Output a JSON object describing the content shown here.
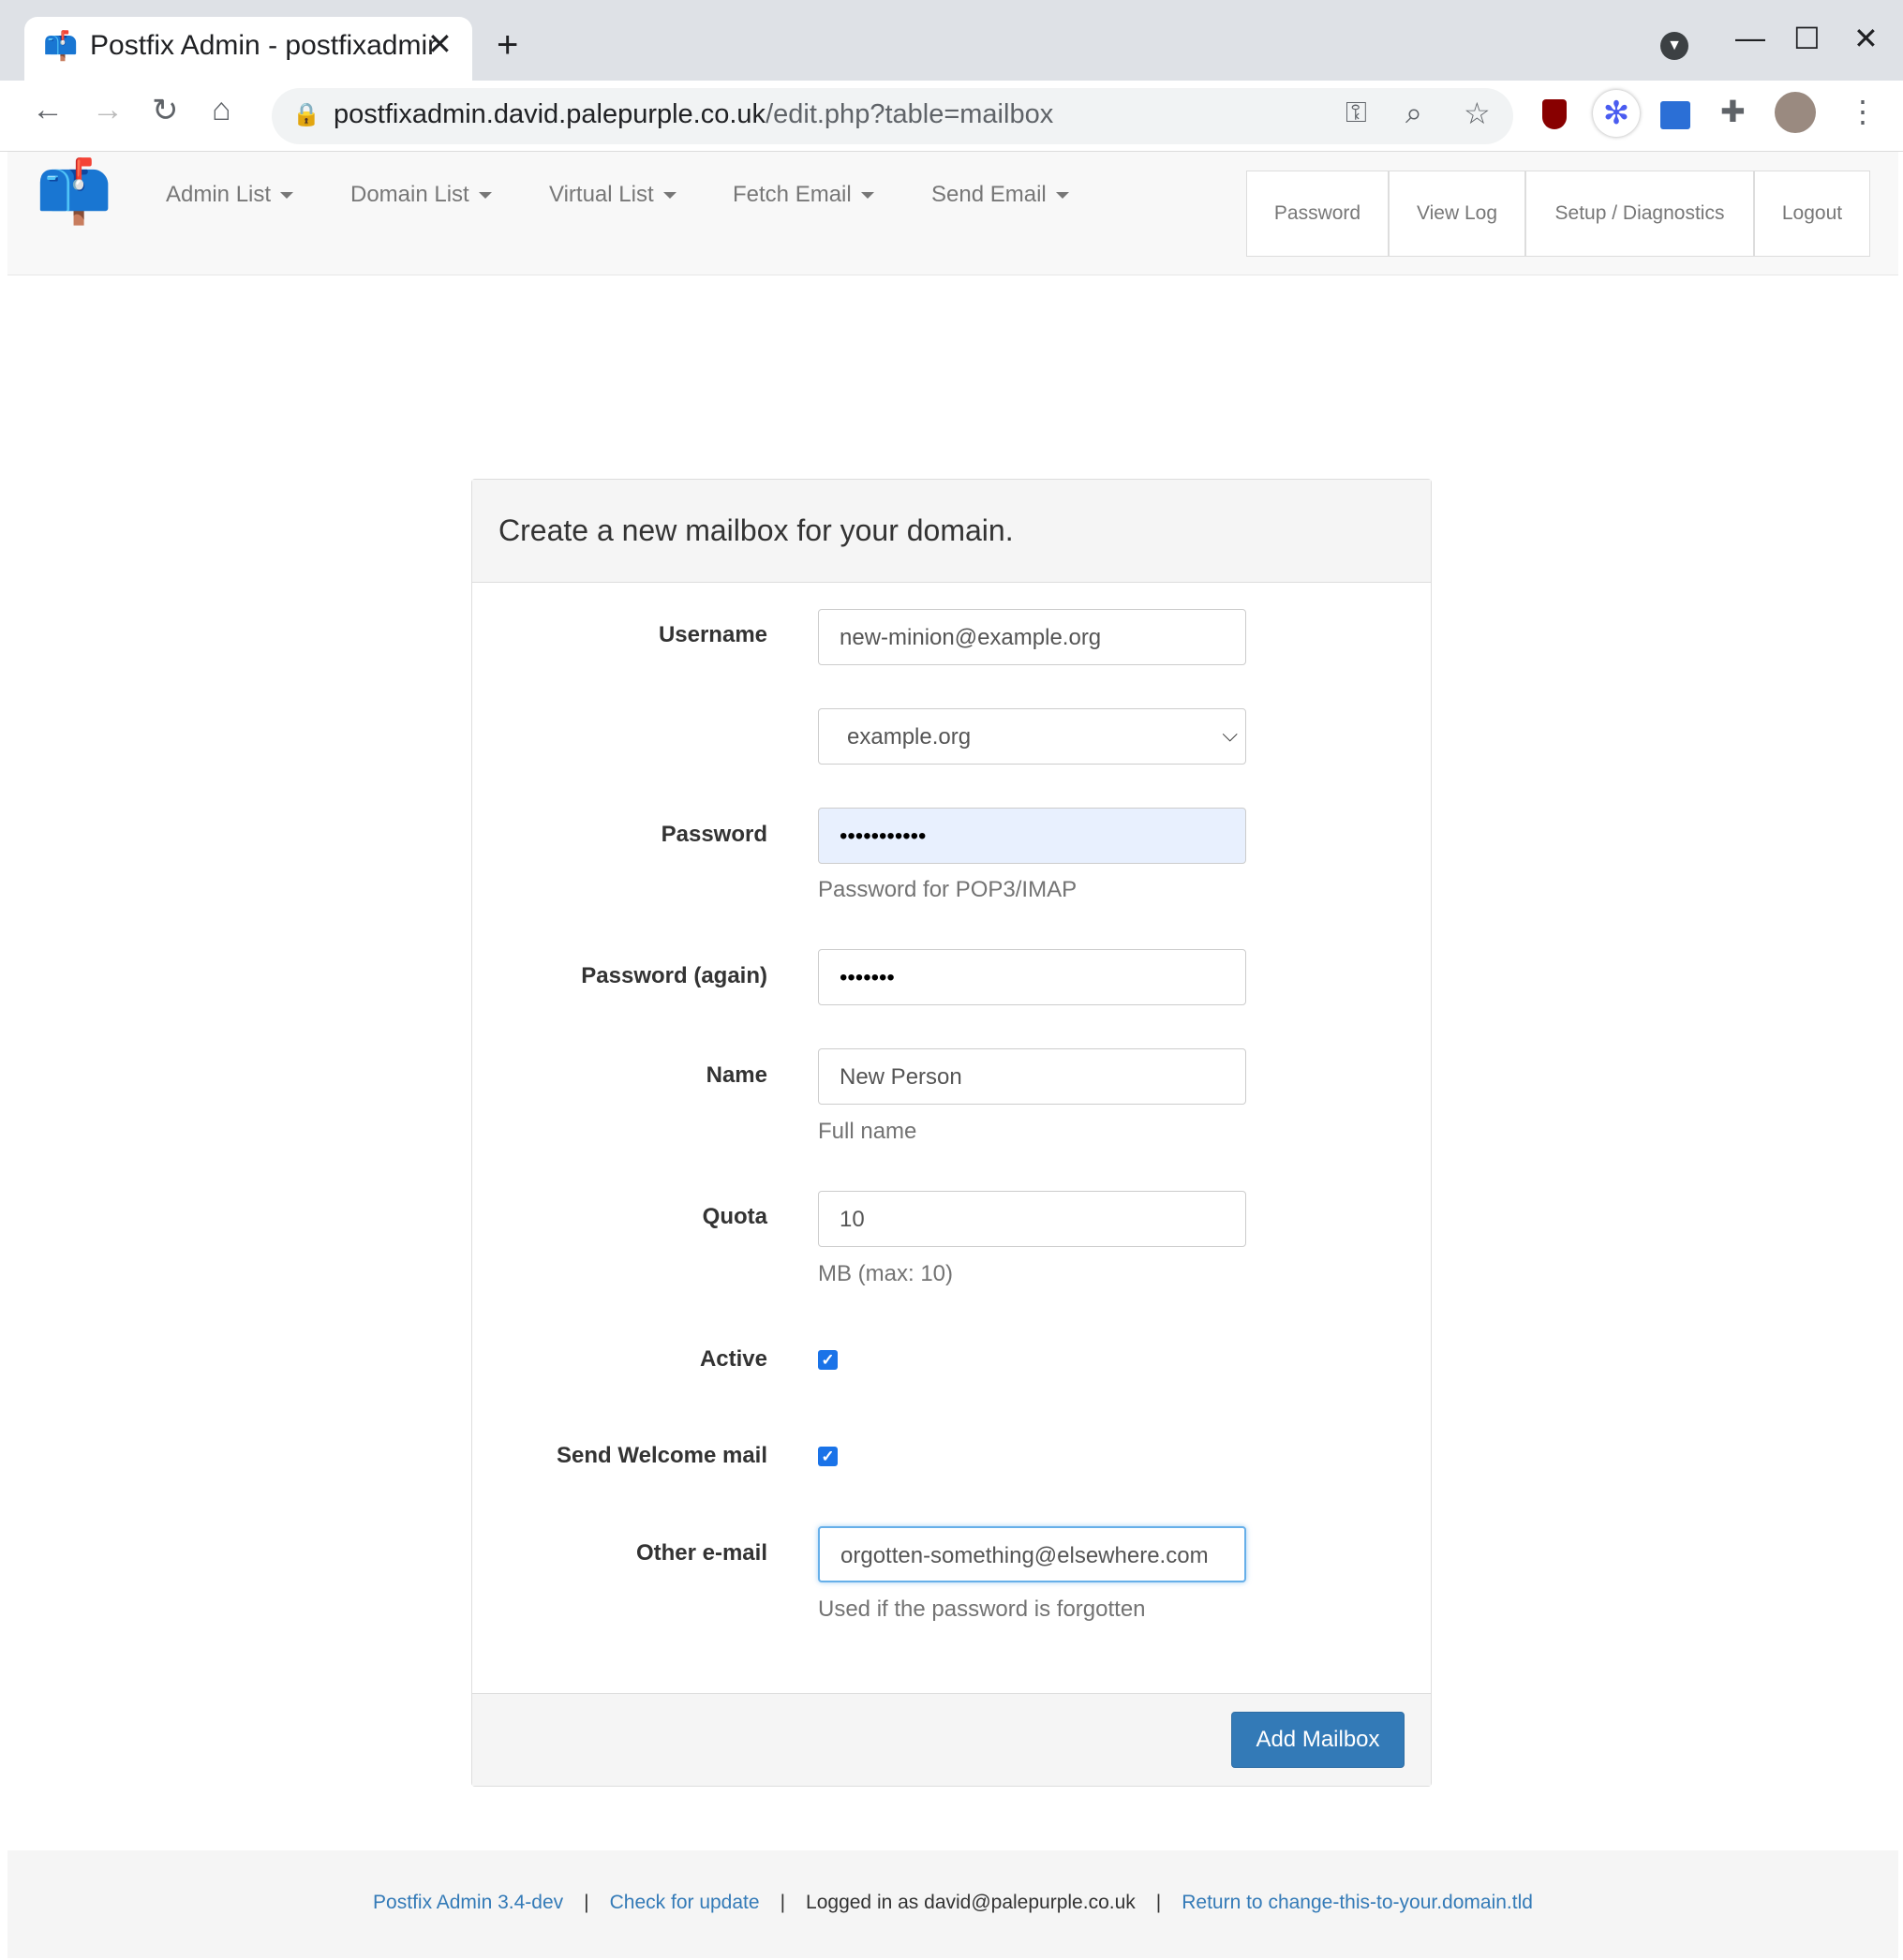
{
  "browser": {
    "tab_title": "Postfix Admin - postfixadmin",
    "url_host": "postfixadmin.david.palepurple.co.uk",
    "url_path": "/edit.php?table=mailbox"
  },
  "nav": {
    "menus": [
      "Admin List",
      "Domain List",
      "Virtual List",
      "Fetch Email",
      "Send Email"
    ],
    "buttons": [
      "Password",
      "View Log",
      "Setup / Diagnostics",
      "Logout"
    ]
  },
  "form": {
    "title": "Create a new mailbox for your domain.",
    "username_label": "Username",
    "username_value": "new-minion@example.org",
    "domain_value": "example.org",
    "password_label": "Password",
    "password_value": "•••••••••••",
    "password_help": "Password for POP3/IMAP",
    "password2_label": "Password (again)",
    "password2_value": "•••••••",
    "name_label": "Name",
    "name_value": "New Person",
    "name_help": "Full name",
    "quota_label": "Quota",
    "quota_value": "10",
    "quota_help": "MB (max: 10)",
    "active_label": "Active",
    "active_checked": true,
    "welcome_label": "Send Welcome mail",
    "welcome_checked": true,
    "other_label": "Other e-mail",
    "other_value": "orgotten-something@elsewhere.com",
    "other_help": "Used if the password is forgotten",
    "submit": "Add Mailbox"
  },
  "footer": {
    "version": "Postfix Admin 3.4-dev",
    "update": "Check for update",
    "logged_in": "Logged in as david@palepurple.co.uk",
    "return": "Return to change-this-to-your.domain.tld",
    "separator": "|"
  },
  "colors": {
    "primary": "#337ab7",
    "checkbox": "#1a73e8",
    "autofill": "#e8f0fe"
  }
}
